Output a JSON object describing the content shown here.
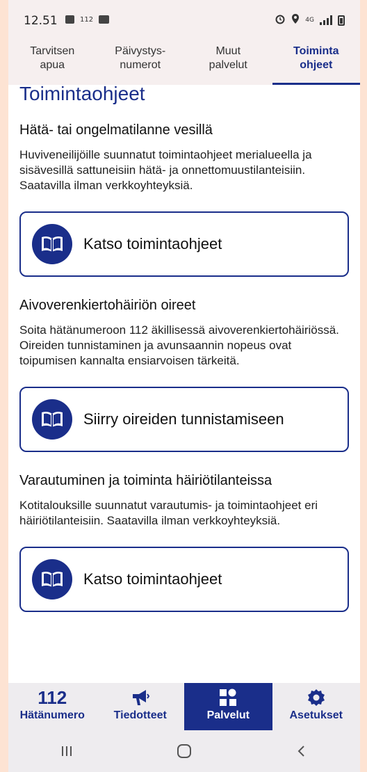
{
  "status": {
    "time": "12.51",
    "left_icon_text": "112",
    "network_label": "4G"
  },
  "top_tabs": [
    {
      "line1": "Tarvitsen",
      "line2": "apua"
    },
    {
      "line1": "Päivystys-",
      "line2": "numerot"
    },
    {
      "line1": "Muut",
      "line2": "palvelut"
    },
    {
      "line1": "Toiminta",
      "line2": "ohjeet"
    }
  ],
  "main": {
    "title": "Toimintaohjeet",
    "sections": [
      {
        "title": "Hätä- tai ongelmatilanne vesillä",
        "text": "Huviveneilijöille suunnatut toimintaohjeet merialueella ja sisävesillä sattuneisiin hätä- ja onnettomuustilanteisiin. Saatavilla ilman verkkoyhteyksiä.",
        "button": "Katso toimintaohjeet"
      },
      {
        "title": "Aivoverenkiertohäiriön oireet",
        "text": "Soita hätänumeroon 112 äkillisessä aivoverenkiertohäiriössä. Oireiden tunnistaminen ja avunsaannin nopeus ovat toipumisen kannalta ensiarvoisen tärkeitä.",
        "button": "Siirry oireiden tunnistamiseen"
      },
      {
        "title": "Varautuminen ja toiminta häiriötilanteissa",
        "text": "Kotitalouksille suunnatut varautumis- ja toimintaohjeet eri häiriötilanteisiin. Saatavilla ilman verkkoyhteyksiä.",
        "button": "Katso toimintaohjeet"
      }
    ]
  },
  "bottom_nav": {
    "emergency_number": "112",
    "items": [
      {
        "label": "Hätänumero"
      },
      {
        "label": "Tiedotteet"
      },
      {
        "label": "Palvelut"
      },
      {
        "label": "Asetukset"
      }
    ]
  },
  "colors": {
    "accent": "#1a2e8a",
    "background_frame": "#fde3d3",
    "header_bg": "#f6efef"
  }
}
